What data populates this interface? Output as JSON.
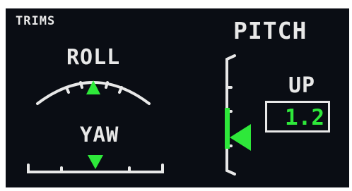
{
  "panel": {
    "title": "TRIMS",
    "roll_label": "ROLL",
    "yaw_label": "YAW",
    "pitch_label": "PITCH",
    "pitch_direction": "UP",
    "pitch_value": "1.2"
  },
  "colors": {
    "background": "#0a0d14",
    "scale": "#e8e8e8",
    "indicator": "#2ee83a"
  },
  "icons": {
    "roll_indicator": "triangle-up",
    "yaw_indicator": "triangle-down",
    "pitch_indicator": "triangle-left"
  }
}
